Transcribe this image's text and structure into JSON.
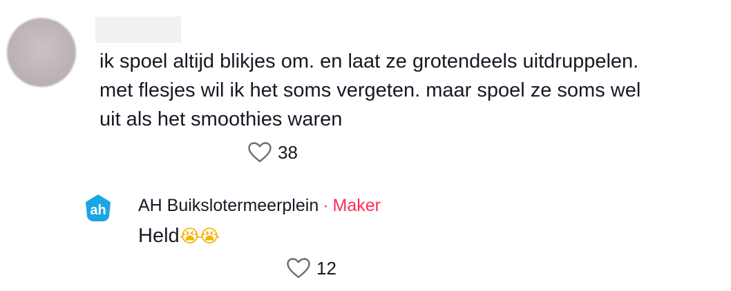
{
  "comment": {
    "text_lines": [
      "ik spoel altijd blikjes om. en laat ze grotendeels uitdruppelen.",
      "met flesjes wil ik het soms vergeten. maar spoel ze soms wel",
      "uit als het smoothies waren"
    ],
    "like_count": "38",
    "like_icon": "heart-outline-icon"
  },
  "reply": {
    "author": "AH Buikslotermeerplein",
    "separator": "·",
    "badge": "Maker",
    "text": "Held",
    "emojis": "😭😭",
    "like_count": "12",
    "like_icon": "heart-outline-icon",
    "avatar_label": "ah"
  },
  "colors": {
    "text": "#161823",
    "maker": "#fe2c55",
    "ah_blue": "#1aa6e4"
  }
}
